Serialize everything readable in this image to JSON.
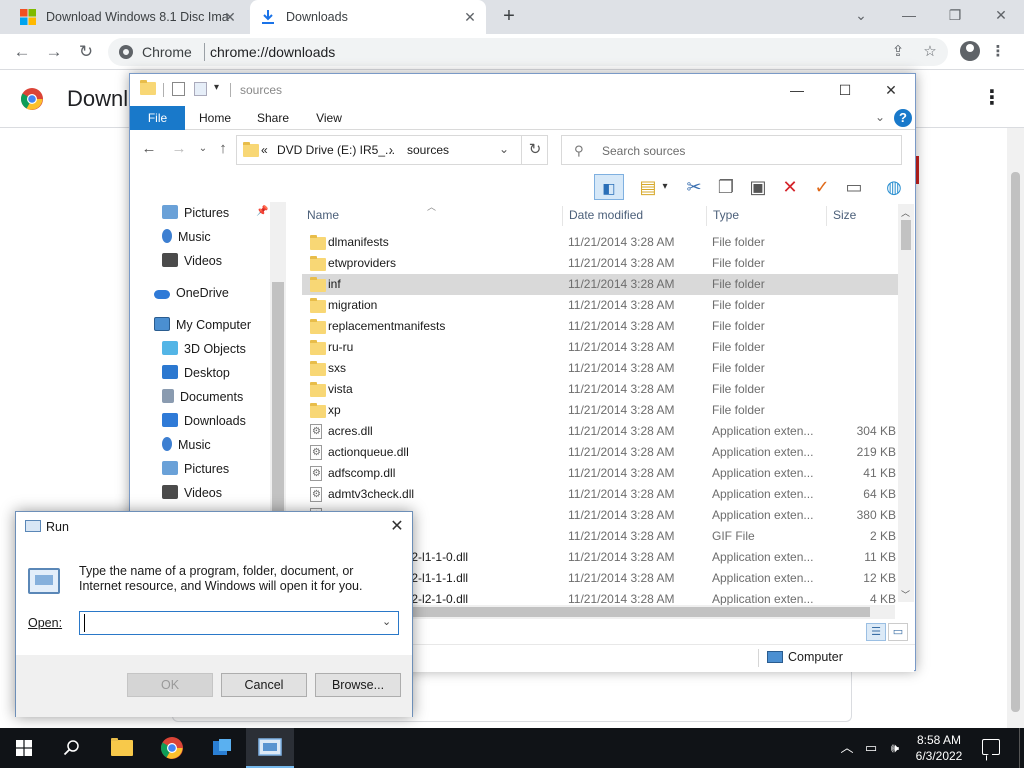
{
  "browser": {
    "tabs": [
      {
        "title": "Download Windows 8.1 Disc Ima",
        "active": false
      },
      {
        "title": "Downloads",
        "active": true
      }
    ],
    "site_label": "Chrome",
    "url": "chrome://downloads",
    "page_title": "Downloads"
  },
  "explorer": {
    "title": "sources",
    "ribbon_tabs": [
      "File",
      "Home",
      "Share",
      "View"
    ],
    "address": {
      "prefix": "«",
      "crumb1": "DVD Drive (E:) IR5_...",
      "crumb2": "sources",
      "sep": "›"
    },
    "search_placeholder": "Search sources",
    "nav_items": [
      {
        "label": "Pictures",
        "icon": "pictures-icon",
        "color": "#6aa1d8",
        "indent": 2
      },
      {
        "label": "Music",
        "icon": "music-icon",
        "color": "#3d7fd1",
        "indent": 2
      },
      {
        "label": "Videos",
        "icon": "videos-icon",
        "color": "#4b4b4b",
        "indent": 2
      },
      {
        "label": "OneDrive",
        "icon": "onedrive-icon",
        "color": "#2f7ad7",
        "indent": 1
      },
      {
        "label": "My Computer",
        "icon": "computer-icon",
        "color": "#4b8fd1",
        "indent": 1
      },
      {
        "label": "3D Objects",
        "icon": "3d-objects-icon",
        "color": "#53b5e6",
        "indent": 2
      },
      {
        "label": "Desktop",
        "icon": "desktop-icon",
        "color": "#2b78d0",
        "indent": 2
      },
      {
        "label": "Documents",
        "icon": "documents-icon",
        "color": "#8a9bb0",
        "indent": 2
      },
      {
        "label": "Downloads",
        "icon": "downloads-icon",
        "color": "#2f7ad7",
        "indent": 2
      },
      {
        "label": "Music",
        "icon": "music-icon",
        "color": "#3d7fd1",
        "indent": 2
      },
      {
        "label": "Pictures",
        "icon": "pictures-icon",
        "color": "#6aa1d8",
        "indent": 2
      },
      {
        "label": "Videos",
        "icon": "videos-icon",
        "color": "#4b4b4b",
        "indent": 2
      }
    ],
    "columns": {
      "name": "Name",
      "date": "Date modified",
      "type": "Type",
      "size": "Size"
    },
    "rows": [
      {
        "name": "dlmanifests",
        "date": "11/21/2014 3:28 AM",
        "type": "File folder",
        "size": "",
        "kind": "folder"
      },
      {
        "name": "etwproviders",
        "date": "11/21/2014 3:28 AM",
        "type": "File folder",
        "size": "",
        "kind": "folder"
      },
      {
        "name": "inf",
        "date": "11/21/2014 3:28 AM",
        "type": "File folder",
        "size": "",
        "kind": "folder",
        "selected": true
      },
      {
        "name": "migration",
        "date": "11/21/2014 3:28 AM",
        "type": "File folder",
        "size": "",
        "kind": "folder"
      },
      {
        "name": "replacementmanifests",
        "date": "11/21/2014 3:28 AM",
        "type": "File folder",
        "size": "",
        "kind": "folder"
      },
      {
        "name": "ru-ru",
        "date": "11/21/2014 3:28 AM",
        "type": "File folder",
        "size": "",
        "kind": "folder"
      },
      {
        "name": "sxs",
        "date": "11/21/2014 3:28 AM",
        "type": "File folder",
        "size": "",
        "kind": "folder"
      },
      {
        "name": "vista",
        "date": "11/21/2014 3:28 AM",
        "type": "File folder",
        "size": "",
        "kind": "folder"
      },
      {
        "name": "xp",
        "date": "11/21/2014 3:28 AM",
        "type": "File folder",
        "size": "",
        "kind": "folder"
      },
      {
        "name": "acres.dll",
        "date": "11/21/2014 3:28 AM",
        "type": "Application exten...",
        "size": "304 KB",
        "kind": "dll"
      },
      {
        "name": "actionqueue.dll",
        "date": "11/21/2014 3:28 AM",
        "type": "Application exten...",
        "size": "219 KB",
        "kind": "dll"
      },
      {
        "name": "adfscomp.dll",
        "date": "11/21/2014 3:28 AM",
        "type": "Application exten...",
        "size": "41 KB",
        "kind": "dll"
      },
      {
        "name": "admtv3check.dll",
        "date": "11/21/2014 3:28 AM",
        "type": "Application exten...",
        "size": "64 KB",
        "kind": "dll"
      },
      {
        "name": "",
        "date": "11/21/2014 3:28 AM",
        "type": "Application exten...",
        "size": "380 KB",
        "kind": "dll"
      },
      {
        "name": "",
        "date": "11/21/2014 3:28 AM",
        "type": "GIF File",
        "size": "2 KB",
        "kind": "dll"
      },
      {
        "name": "vnlevel-advapi32-l1-1-0.dll",
        "date": "11/21/2014 3:28 AM",
        "type": "Application exten...",
        "size": "11 KB",
        "kind": "none"
      },
      {
        "name": "vnlevel-advapi32-l1-1-1.dll",
        "date": "11/21/2014 3:28 AM",
        "type": "Application exten...",
        "size": "12 KB",
        "kind": "none"
      },
      {
        "name": "vnlevel-advapi32-l2-1-0.dll",
        "date": "11/21/2014 3:28 AM",
        "type": "Application exten...",
        "size": "4 KB",
        "kind": "none"
      }
    ],
    "status_location": "Computer"
  },
  "run_dialog": {
    "title": "Run",
    "description": "Type the name of a program, folder, document, or Internet resource, and Windows will open it for you.",
    "open_label": "Open:",
    "open_value": "",
    "ok_label": "OK",
    "cancel_label": "Cancel",
    "browse_label": "Browse..."
  },
  "taskbar": {
    "time": "8:58 AM",
    "date": "6/3/2022"
  },
  "colors": {
    "ribbon_file": "#1979ca",
    "folder": "#f8d775",
    "taskbar": "#101317",
    "selected_row": "#d9d9d9"
  }
}
